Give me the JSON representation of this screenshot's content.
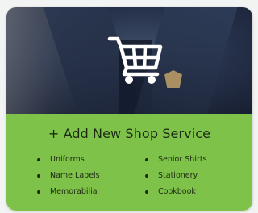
{
  "card": {
    "title": "+ Add New Shop Service",
    "icon": "shopping-cart-icon",
    "accent_color": "#7ec24a",
    "services_left": [
      {
        "label": "Uniforms"
      },
      {
        "label": "Name Labels"
      },
      {
        "label": "Memorabilia"
      }
    ],
    "services_right": [
      {
        "label": "Senior Shirts"
      },
      {
        "label": "Stationery"
      },
      {
        "label": "Cookbook"
      }
    ]
  }
}
